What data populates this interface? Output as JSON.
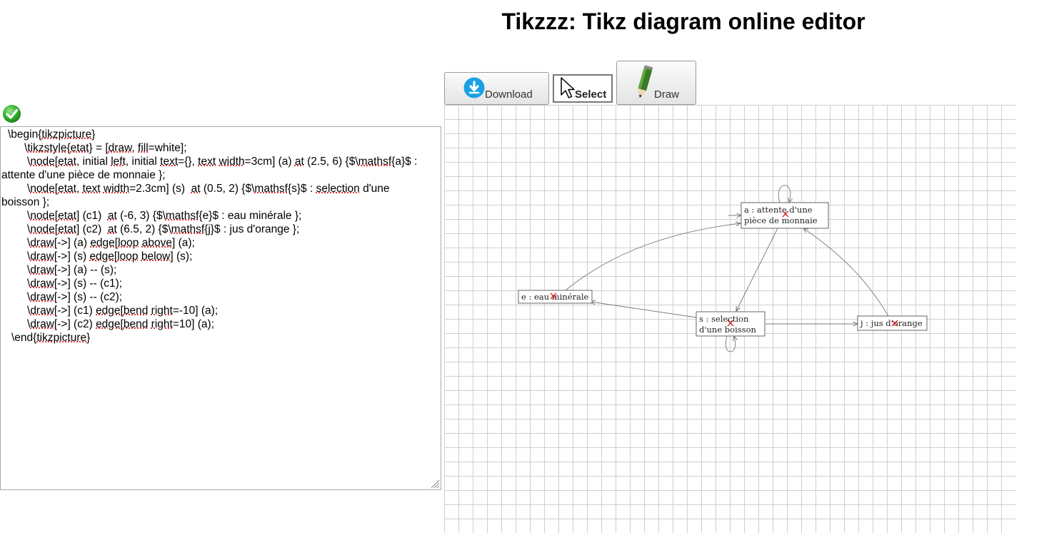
{
  "header": {
    "title": "Tikzzz: Tikz diagram online editor"
  },
  "status": {
    "icon": "check-icon",
    "color": "#2fa82f"
  },
  "toolbar": {
    "download_label": "Download",
    "select_label": "Select",
    "draw_label": "Draw",
    "download_icon": "download-icon",
    "select_icon": "cursor-icon",
    "draw_icon": "pencil-icon",
    "download_color": "#1ba1e2"
  },
  "editor": {
    "lines": [
      "\\begin{tikzpicture}",
      "\\tikzstyle{etat} = [draw, fill=white];",
      "\\node[etat, initial left, initial text={}, text width=3cm] (a) at (2.5, 6) {$\\mathsf{a}$ :",
      "attente d'une pièce de monnaie };",
      "\\node[etat, text width=2.3cm] (s)  at (0.5, 2) {$\\mathsf{s}$ : selection d'une",
      "boisson };",
      "\\node[etat] (c1)  at (-6, 3) {$\\mathsf{e}$ : eau minérale };",
      "\\node[etat] (c2)  at (6.5, 2) {$\\mathsf{j}$ : jus d'orange };",
      "\\draw[->] (a) edge[loop above] (a);",
      "\\draw[->] (s) edge[loop below] (s);",
      "\\draw[->] (a) -- (s);",
      "\\draw[->] (s) -- (c1);",
      "\\draw[->] (s) -- (c2);",
      "\\draw[->] (c1) edge[bend right=-10] (a);",
      "\\draw[->] (c2) edge[bend right=10] (a);",
      "\\end{tikzpicture}"
    ]
  },
  "diagram": {
    "nodes": {
      "a": {
        "line1": "a :  attente d'une",
        "line2": "pièce de monnaie"
      },
      "s": {
        "line1": "s :  selection",
        "line2": "d'une boisson"
      },
      "e": {
        "label": "e :  eau minérale"
      },
      "j": {
        "label": "j :  jus d'orange"
      }
    },
    "marker_color": "#d42020"
  }
}
